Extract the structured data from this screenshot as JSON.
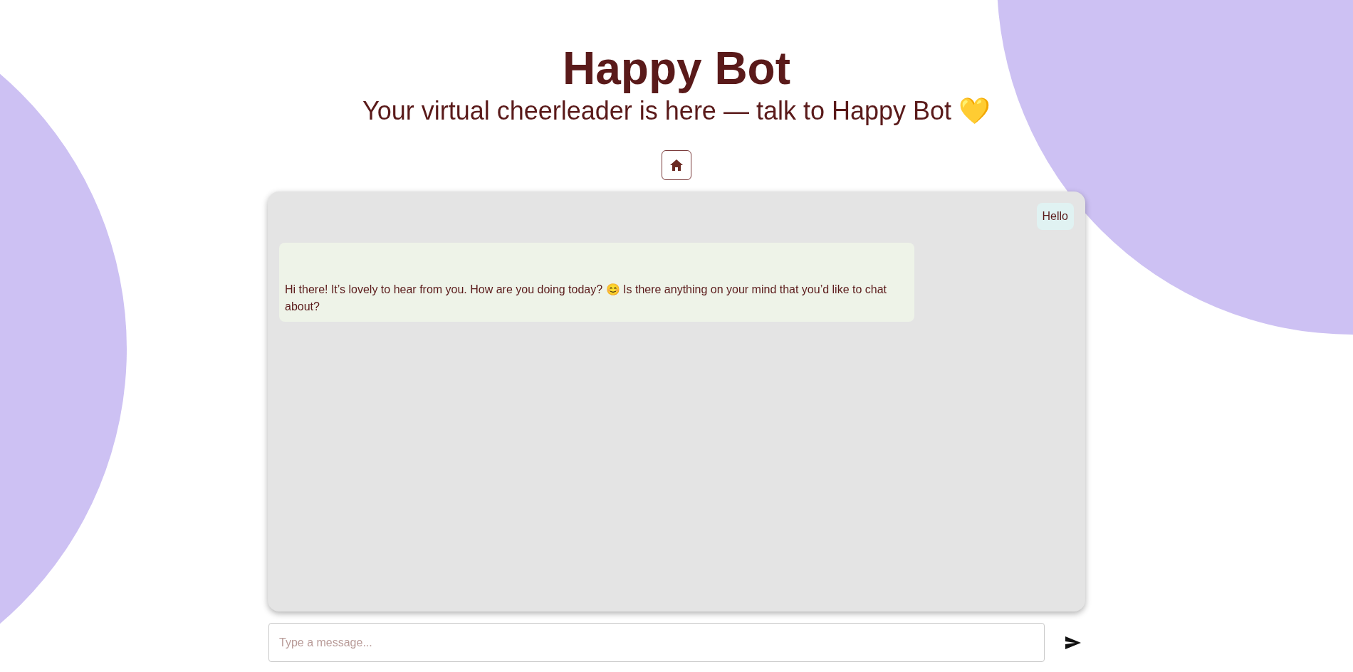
{
  "header": {
    "title": "Happy Bot",
    "subtitle": "Your virtual cheerleader is here — talk to Happy Bot 💛"
  },
  "messages": [
    {
      "kind": "user",
      "text": "Hello"
    },
    {
      "kind": "bot",
      "text": "Hi there! It’s lovely to hear from you. How are you doing today? 😊 Is there anything on your mind that you’d like to chat about?"
    }
  ],
  "composer": {
    "placeholder": "Type a message..."
  }
}
